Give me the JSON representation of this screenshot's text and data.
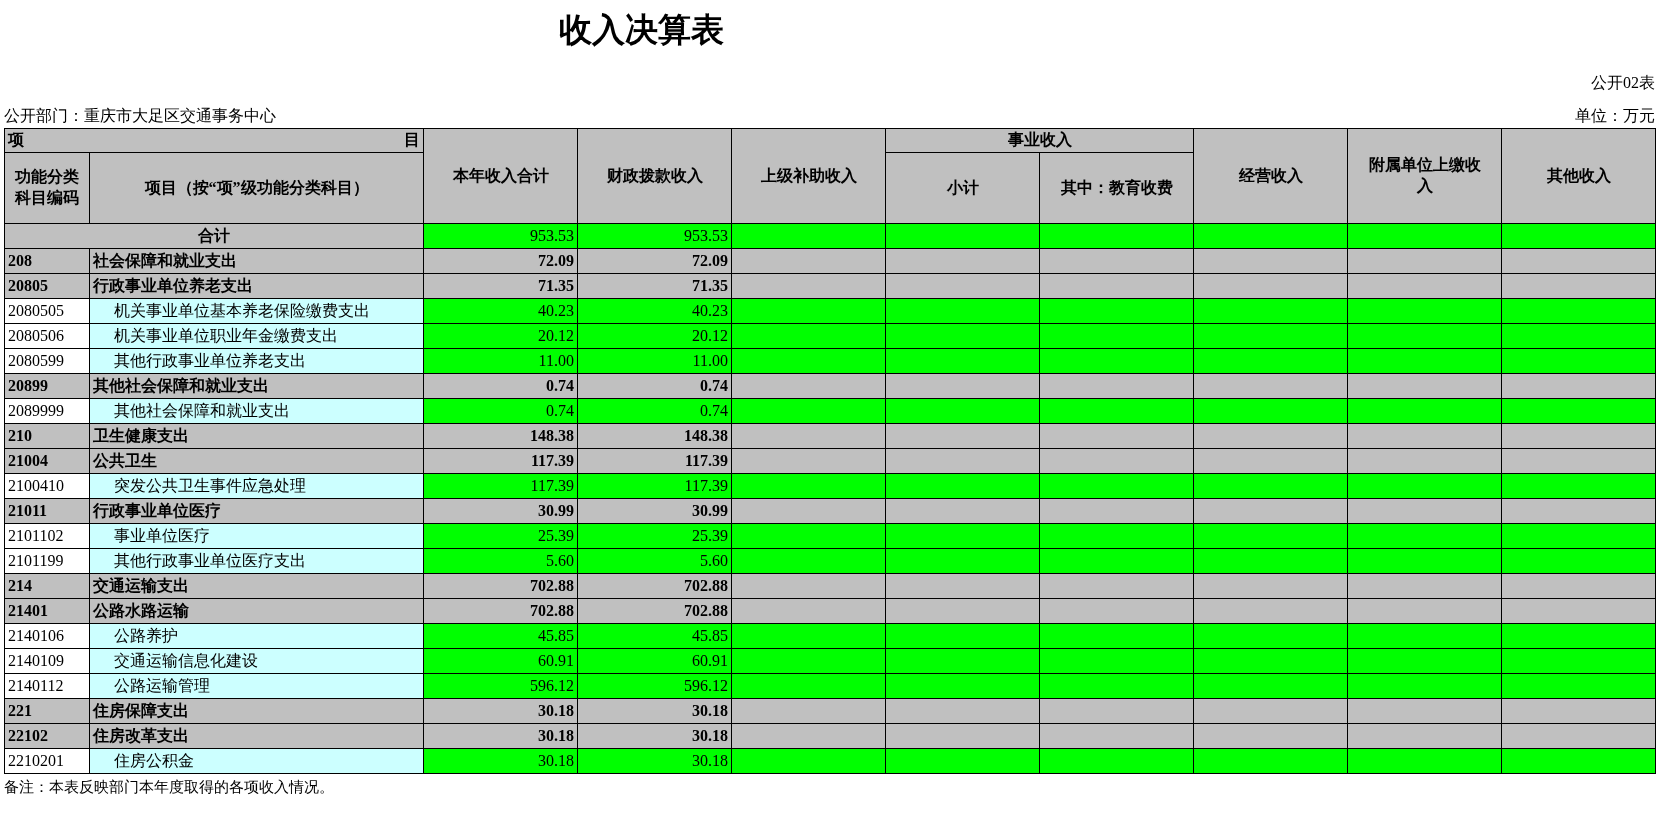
{
  "title": "收入决算表",
  "form_no": "公开02表",
  "department": "公开部门：重庆市大足区交通事务中心",
  "unit": "单位：万元",
  "header": {
    "item_left": "项",
    "item_right": "目",
    "code": "功能分类科目编码",
    "name": "项目（按“项”级功能分类科目）",
    "columns": [
      {
        "label": "本年收入合计"
      },
      {
        "label": "财政拨款收入"
      },
      {
        "label": "上级补助收入"
      },
      {
        "label": "事业收入",
        "children": [
          "小计",
          "其中：教育收费"
        ]
      },
      {
        "label": "经营收入"
      },
      {
        "label": "附属单位上缴收入"
      },
      {
        "label": "其他收入"
      }
    ]
  },
  "total": {
    "label": "合计",
    "values": [
      "953.53",
      "953.53"
    ]
  },
  "rows": [
    {
      "kind": "group",
      "code": "208",
      "name": "社会保障和就业支出",
      "values": [
        "72.09",
        "72.09"
      ]
    },
    {
      "kind": "group",
      "code": "20805",
      "name": "行政事业单位养老支出",
      "values": [
        "71.35",
        "71.35"
      ]
    },
    {
      "kind": "item",
      "code": "2080505",
      "name": "机关事业单位基本养老保险缴费支出",
      "values": [
        "40.23",
        "40.23"
      ]
    },
    {
      "kind": "item",
      "code": "2080506",
      "name": "机关事业单位职业年金缴费支出",
      "values": [
        "20.12",
        "20.12"
      ]
    },
    {
      "kind": "item",
      "code": "2080599",
      "name": "其他行政事业单位养老支出",
      "values": [
        "11.00",
        "11.00"
      ]
    },
    {
      "kind": "group",
      "code": "20899",
      "name": "其他社会保障和就业支出",
      "values": [
        "0.74",
        "0.74"
      ]
    },
    {
      "kind": "item",
      "code": "2089999",
      "name": "其他社会保障和就业支出",
      "values": [
        "0.74",
        "0.74"
      ]
    },
    {
      "kind": "group",
      "code": "210",
      "name": "卫生健康支出",
      "values": [
        "148.38",
        "148.38"
      ]
    },
    {
      "kind": "group",
      "code": "21004",
      "name": "公共卫生",
      "values": [
        "117.39",
        "117.39"
      ]
    },
    {
      "kind": "item",
      "code": "2100410",
      "name": "突发公共卫生事件应急处理",
      "values": [
        "117.39",
        "117.39"
      ]
    },
    {
      "kind": "group",
      "code": "21011",
      "name": "行政事业单位医疗",
      "values": [
        "30.99",
        "30.99"
      ]
    },
    {
      "kind": "item",
      "code": "2101102",
      "name": "事业单位医疗",
      "values": [
        "25.39",
        "25.39"
      ]
    },
    {
      "kind": "item",
      "code": "2101199",
      "name": "其他行政事业单位医疗支出",
      "values": [
        "5.60",
        "5.60"
      ]
    },
    {
      "kind": "group",
      "code": "214",
      "name": "交通运输支出",
      "values": [
        "702.88",
        "702.88"
      ]
    },
    {
      "kind": "group",
      "code": "21401",
      "name": "公路水路运输",
      "values": [
        "702.88",
        "702.88"
      ]
    },
    {
      "kind": "item",
      "code": "2140106",
      "name": "公路养护",
      "values": [
        "45.85",
        "45.85"
      ]
    },
    {
      "kind": "item",
      "code": "2140109",
      "name": "交通运输信息化建设",
      "values": [
        "60.91",
        "60.91"
      ]
    },
    {
      "kind": "item",
      "code": "2140112",
      "name": "公路运输管理",
      "values": [
        "596.12",
        "596.12"
      ]
    },
    {
      "kind": "group",
      "code": "221",
      "name": "住房保障支出",
      "values": [
        "30.18",
        "30.18"
      ]
    },
    {
      "kind": "group",
      "code": "22102",
      "name": "住房改革支出",
      "values": [
        "30.18",
        "30.18"
      ]
    },
    {
      "kind": "item",
      "code": "2210201",
      "name": "住房公积金",
      "values": [
        "30.18",
        "30.18"
      ]
    }
  ],
  "note": "备注：本表反映部门本年度取得的各项收入情况。"
}
